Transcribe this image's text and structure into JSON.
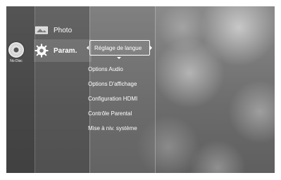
{
  "disc": {
    "label": "No Disc",
    "icon": "disc-icon"
  },
  "main_menu": [
    {
      "label": "Photo",
      "icon": "photo-icon",
      "selected": false
    },
    {
      "label": "Param.",
      "icon": "settings-gear-icon",
      "selected": true
    }
  ],
  "submenu": {
    "selected": "Réglage de langue",
    "items": [
      "Options Audio",
      "Options D'affichage",
      "Configuration HDMI",
      "Contrôle Parental",
      "Mise à niv. système"
    ]
  },
  "colors": {
    "text": "#ffffff",
    "highlight_border": "#ffffff"
  }
}
